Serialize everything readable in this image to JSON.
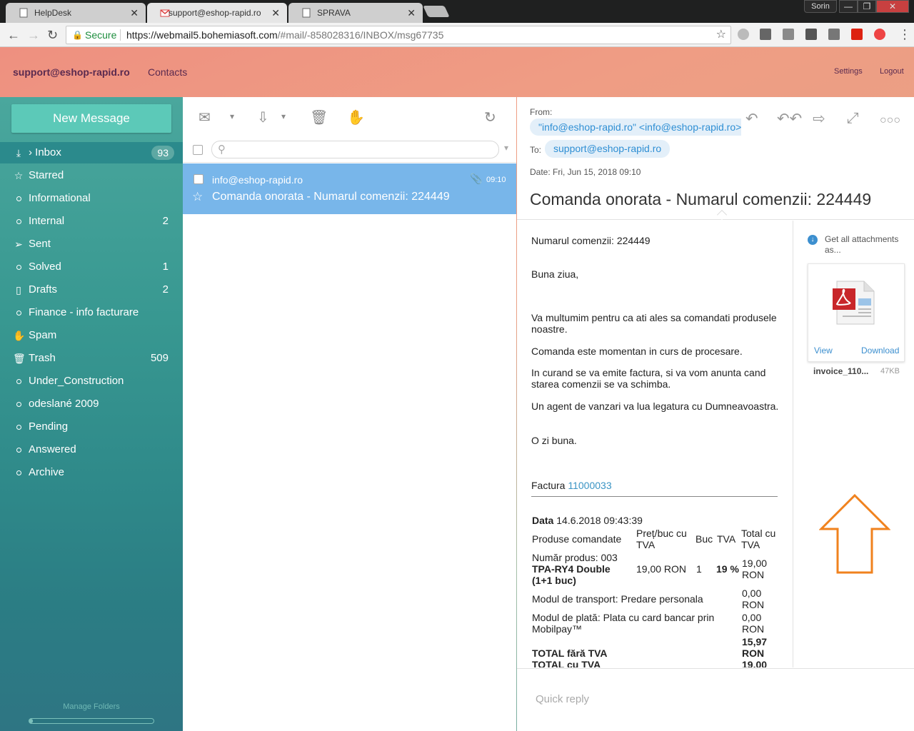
{
  "browser": {
    "tabs": [
      {
        "title": "HelpDesk"
      },
      {
        "title": "support@eshop-rapid.ro"
      },
      {
        "title": "SPRAVA"
      }
    ],
    "user": "Sorin",
    "secure_label": "Secure",
    "url_host": "https://webmail5.bohemiasoft.com",
    "url_path": "/#mail/-858028316/INBOX/msg67735"
  },
  "header": {
    "account": "support@eshop-rapid.ro",
    "contacts": "Contacts",
    "settings": "Settings",
    "logout": "Logout"
  },
  "sidebar": {
    "new_message": "New Message",
    "folders": [
      {
        "name": "Inbox",
        "count": "93",
        "icon": "inbox-icon"
      },
      {
        "name": "Starred",
        "count": "",
        "icon": "star-icon"
      },
      {
        "name": "Informational",
        "count": "",
        "icon": "folder-dot-icon"
      },
      {
        "name": "Internal",
        "count": "2",
        "icon": "folder-dot-icon"
      },
      {
        "name": "Sent",
        "count": "",
        "icon": "send-icon"
      },
      {
        "name": "Solved",
        "count": "1",
        "icon": "folder-dot-icon"
      },
      {
        "name": "Drafts",
        "count": "2",
        "icon": "draft-icon"
      },
      {
        "name": "Finance - info facturare",
        "count": "",
        "icon": "folder-dot-icon"
      },
      {
        "name": "Spam",
        "count": "",
        "icon": "spam-icon"
      },
      {
        "name": "Trash",
        "count": "509",
        "icon": "trash-icon"
      },
      {
        "name": "Under_Construction",
        "count": "",
        "icon": "folder-dot-icon"
      },
      {
        "name": "odeslané 2009",
        "count": "",
        "icon": "folder-dot-icon"
      },
      {
        "name": "Pending",
        "count": "",
        "icon": "folder-dot-icon"
      },
      {
        "name": "Answered",
        "count": "",
        "icon": "folder-dot-icon"
      },
      {
        "name": "Archive",
        "count": "",
        "icon": "folder-dot-icon"
      }
    ],
    "manage_folders": "Manage Folders",
    "quota_fraction": 0.03
  },
  "list": {
    "search_placeholder": "",
    "message": {
      "from": "info@eshop-rapid.ro",
      "subject": "Comanda onorata - Numarul comenzii: 224449",
      "time": "09:10",
      "has_attachment": true
    }
  },
  "reader": {
    "from_label": "From:",
    "from_value": "\"info@eshop-rapid.ro\" <info@eshop-rapid.ro>",
    "to_label": "To:",
    "to_value": "support@eshop-rapid.ro",
    "date": "Date: Fri, Jun 15, 2018 09:10",
    "subject": "Comanda onorata - Numarul comenzii: 224449",
    "body": {
      "order_no": "Numarul comenzii: 224449",
      "greeting": "Buna ziua,",
      "p1": "Va multumim pentru ca ati ales sa comandati produsele noastre.",
      "p2": "Comanda este momentan in curs de procesare.",
      "p3": "In curand se va emite factura, si va vom anunta cand starea comenzii se va schimba.",
      "p4": "Un agent de vanzari va lua legatura cu Dumneavoastra.",
      "p5": "O zi buna.",
      "factura_label": "Factura",
      "factura_no": "11000033"
    },
    "invoice": {
      "data_label": "Data",
      "data_value": "14.6.2018 09:43:39",
      "col_products": "Produse comandate",
      "col_unit_price": "Preț/buc cu TVA",
      "col_qty": "Buc",
      "col_vat": "TVA",
      "col_total": "Total cu TVA",
      "product_no": "Număr produs: 003",
      "product_name": "TPA-RY4 Double (1+1 buc)",
      "product_price": "19,00 RON",
      "product_qty": "1",
      "product_vat": "19 %",
      "product_total": "19,00 RON",
      "transport": "Modul de transport: Predare personala",
      "transport_total": "0,00 RON",
      "payment": "Modul de plată: Plata cu card bancar prin Mobilpay™",
      "payment_total": "0,00 RON",
      "total_no_vat_label": "TOTAL fără TVA",
      "total_no_vat": "15,97 RON",
      "total_vat_label": "TOTAL cu TVA",
      "total_vat": "19,00"
    },
    "attachments": {
      "get_all": "Get all attachments as...",
      "view": "View",
      "download": "Download",
      "name": "invoice_110...",
      "size": "47KB"
    },
    "quick_reply": "Quick reply"
  }
}
